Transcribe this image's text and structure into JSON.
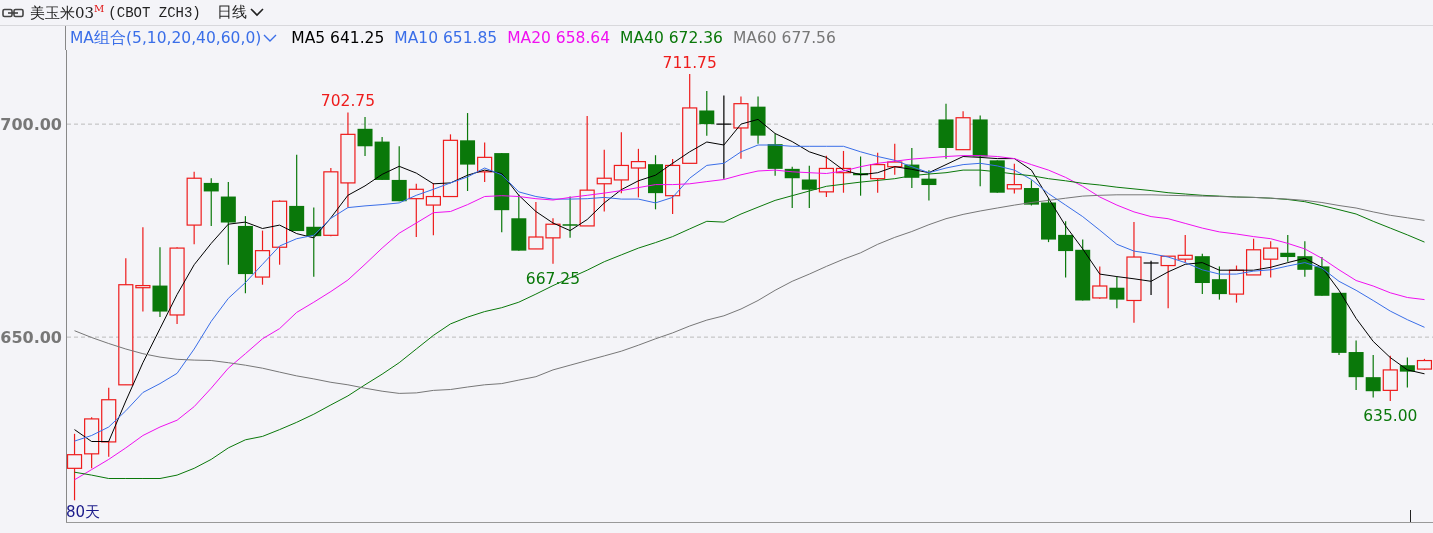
{
  "header": {
    "title": "美玉米03$^{M}$",
    "exchange": "(CBOT ZCH3)",
    "period": "日线"
  },
  "legend": {
    "indicator": "MA组合(5,10,20,40,60,0)",
    "values": [
      "641.25",
      "651.85",
      "658.64",
      "672.36",
      "677.56"
    ]
  },
  "chart": {
    "span_label": "80天",
    "chart_data": {
      "type": "candlestick",
      "categories": [
        null,
        null,
        null,
        null,
        null,
        null,
        null,
        null,
        null,
        null,
        null,
        null,
        null,
        null,
        null,
        null,
        null,
        null,
        null,
        null,
        null,
        null,
        null,
        null,
        null,
        null,
        null,
        null,
        null,
        null,
        null,
        null,
        null,
        null,
        null,
        null,
        null,
        null,
        null,
        null,
        null,
        null,
        null,
        null,
        null,
        null,
        null,
        null,
        null,
        null,
        null,
        null,
        null,
        null,
        null,
        null,
        null,
        null,
        null,
        null,
        null,
        null,
        null,
        null,
        null,
        null,
        null,
        null,
        null,
        null,
        null,
        null,
        null,
        null,
        null,
        null,
        null,
        null,
        null,
        null
      ],
      "ylim": [
        606.6,
        722.8
      ],
      "yticks": [
        {
          "value": 650,
          "label": "650.00"
        },
        {
          "value": 700,
          "label": "700.00"
        }
      ],
      "ohlc": [
        [
          619.2,
          627.3,
          611.7,
          622.4
        ],
        [
          622.6,
          631.2,
          619.2,
          630.8
        ],
        [
          625.4,
          638.1,
          621.9,
          635.3
        ],
        [
          638.8,
          668.5,
          638.8,
          662.3
        ],
        [
          661.6,
          675.8,
          656.0,
          662.1
        ],
        [
          662.1,
          671.1,
          654.7,
          656.0
        ],
        [
          655.2,
          671.1,
          653.1,
          670.9
        ],
        [
          676.3,
          688.8,
          671.8,
          687.3
        ],
        [
          686.2,
          687.3,
          676.1,
          684.2
        ],
        [
          683.0,
          686.4,
          667.0,
          676.9
        ],
        [
          676.1,
          678.4,
          660.3,
          664.8
        ],
        [
          664.1,
          675.0,
          662.3,
          670.3
        ],
        [
          671.1,
          682.1,
          667.0,
          681.9
        ],
        [
          680.8,
          692.8,
          674.9,
          674.9
        ],
        [
          675.9,
          680.4,
          664.2,
          673.7
        ],
        [
          673.9,
          689.7,
          673.7,
          688.8
        ],
        [
          686.2,
          702.75,
          680.4,
          697.6
        ],
        [
          698.9,
          701.7,
          692.5,
          694.8
        ],
        [
          695.9,
          697.0,
          686.9,
          686.9
        ],
        [
          686.9,
          694.8,
          681.9,
          681.9
        ],
        [
          682.5,
          686.0,
          673.5,
          684.7
        ],
        [
          681.0,
          686.2,
          673.9,
          683.0
        ],
        [
          683.0,
          697.6,
          683.0,
          696.2
        ],
        [
          696.2,
          702.6,
          684.3,
          690.5
        ],
        [
          688.8,
          695.7,
          686.4,
          692.2
        ],
        [
          693.2,
          693.2,
          674.6,
          679.8
        ],
        [
          677.9,
          683.4,
          670.3,
          670.3
        ],
        [
          670.7,
          681.7,
          670.7,
          673.5
        ],
        [
          673.3,
          677.9,
          667.25,
          676.5
        ],
        [
          676.5,
          683.0,
          673.3,
          676.2
        ],
        [
          676.1,
          701.9,
          676.1,
          684.5
        ],
        [
          686.0,
          694.0,
          679.5,
          687.3
        ],
        [
          686.9,
          698.1,
          683.8,
          690.3
        ],
        [
          689.7,
          694.2,
          682.8,
          691.2
        ],
        [
          690.6,
          692.7,
          680.0,
          683.8
        ],
        [
          683.2,
          691.8,
          678.9,
          690.3
        ],
        [
          690.8,
          711.75,
          690.8,
          703.8
        ],
        [
          703.2,
          707.8,
          697.3,
          700.0
        ],
        [
          700.0,
          706.7,
          687.2,
          700.0
        ],
        [
          699.1,
          706.5,
          691.9,
          704.8
        ],
        [
          704.1,
          706.5,
          695.4,
          697.3
        ],
        [
          695.3,
          697.8,
          687.9,
          689.5
        ],
        [
          689.5,
          690.0,
          680.3,
          687.3
        ],
        [
          687.0,
          690.2,
          680.3,
          684.6
        ],
        [
          684.1,
          692.6,
          682.9,
          689.6
        ],
        [
          688.6,
          693.7,
          683.9,
          689.6
        ],
        [
          688.5,
          692.4,
          683.2,
          688.0
        ],
        [
          687.2,
          693.3,
          683.9,
          690.5
        ],
        [
          690.0,
          695.4,
          688.1,
          691.1
        ],
        [
          690.5,
          694.4,
          685.0,
          687.4
        ],
        [
          687.2,
          689.2,
          682.1,
          685.7
        ],
        [
          701.1,
          704.8,
          691.9,
          694.4
        ],
        [
          694.0,
          703.0,
          694.0,
          701.5
        ],
        [
          701.1,
          702.0,
          685.4,
          692.4
        ],
        [
          691.5,
          691.5,
          683.9,
          683.9
        ],
        [
          684.8,
          690.7,
          683.7,
          685.8
        ],
        [
          685.0,
          686.8,
          680.9,
          681.1
        ],
        [
          681.6,
          682.6,
          672.3,
          672.9
        ],
        [
          674.0,
          677.2,
          664.0,
          670.2
        ],
        [
          670.5,
          672.9,
          658.6,
          658.6
        ],
        [
          659.2,
          666.6,
          659.0,
          662.0
        ],
        [
          661.6,
          664.2,
          656.8,
          658.8
        ],
        [
          658.6,
          677.0,
          653.4,
          668.8
        ],
        [
          667.4,
          667.9,
          659.9,
          667.4
        ],
        [
          666.8,
          669.0,
          656.8,
          669.0
        ],
        [
          668.3,
          674.0,
          667.5,
          669.2
        ],
        [
          669.0,
          669.6,
          660.1,
          662.7
        ],
        [
          663.6,
          666.6,
          658.8,
          660.1
        ],
        [
          660.1,
          666.8,
          658.1,
          665.7
        ],
        [
          664.6,
          673.1,
          664.6,
          670.5
        ],
        [
          668.3,
          672.5,
          664.0,
          670.9
        ],
        [
          669.8,
          674.0,
          667.7,
          668.8
        ],
        [
          669.0,
          672.5,
          664.2,
          665.8
        ],
        [
          666.6,
          668.8,
          659.7,
          659.7
        ],
        [
          660.4,
          660.4,
          645.8,
          646.3
        ],
        [
          646.5,
          649.2,
          637.6,
          640.6
        ],
        [
          640.6,
          645.8,
          635.8,
          637.3
        ],
        [
          637.5,
          645.6,
          635.0,
          642.3
        ],
        [
          643.4,
          645.2,
          638.2,
          641.9
        ],
        [
          642.5,
          644.9,
          642.3,
          644.5
        ]
      ],
      "series": [
        {
          "name": "MA5",
          "type": "line",
          "color": "#000000",
          "values": [
            628.3,
            625.5,
            625.5,
            635.0,
            644.0,
            652.0,
            660.0,
            667.0,
            672.0,
            676.5,
            677.0,
            675.5,
            676.3,
            674.3,
            673.3,
            678.0,
            683.3,
            685.5,
            688.2,
            690.1,
            688.5,
            686.0,
            686.2,
            688.0,
            689.2,
            688.4,
            683.3,
            679.5,
            676.8,
            675.0,
            677.6,
            681.5,
            684.6,
            686.7,
            688.0,
            690.8,
            693.5,
            695.8,
            695.1,
            700.0,
            701.1,
            697.8,
            695.9,
            693.5,
            692.2,
            689.2,
            688.1,
            688.6,
            690.0,
            689.4,
            688.6,
            690.5,
            692.4,
            692.2,
            691.9,
            691.9,
            689.2,
            682.6,
            676.1,
            670.7,
            664.8,
            664.2,
            663.7,
            663.1,
            665.3,
            667.1,
            667.5,
            665.7,
            665.7,
            665.7,
            666.4,
            667.5,
            668.5,
            666.4,
            661.0,
            654.4,
            649.0,
            645.2,
            642.3,
            641.4
          ]
        },
        {
          "name": "MA10",
          "type": "line",
          "color": "#3a6ee8",
          "values": [
            625.6,
            626.9,
            628.9,
            632.7,
            637.0,
            639.1,
            641.5,
            647.2,
            653.7,
            659.1,
            662.8,
            667.1,
            671.4,
            673.1,
            673.9,
            677.9,
            680.4,
            680.8,
            681.1,
            681.5,
            683.3,
            684.7,
            686.2,
            687.6,
            689.7,
            688.1,
            684.1,
            683.0,
            682.4,
            682.4,
            682.5,
            682.8,
            682.4,
            682.4,
            681.5,
            682.8,
            687.3,
            690.3,
            690.8,
            693.5,
            695.1,
            695.1,
            694.8,
            694.8,
            694.8,
            694.8,
            693.5,
            692.4,
            691.5,
            690.0,
            688.6,
            689.7,
            690.5,
            690.8,
            690.2,
            689.2,
            687.0,
            683.7,
            681.0,
            678.3,
            675.1,
            671.8,
            670.2,
            669.6,
            668.8,
            667.5,
            665.8,
            664.8,
            664.8,
            665.5,
            665.8,
            666.7,
            667.5,
            666.2,
            663.1,
            661.0,
            658.6,
            656.1,
            654.1,
            652.3
          ]
        },
        {
          "name": "MA20",
          "type": "line",
          "color": "#f010f0",
          "values": [
            616.5,
            618.9,
            621.3,
            624.0,
            626.9,
            628.9,
            630.5,
            633.7,
            638.0,
            642.7,
            646.1,
            649.6,
            652.0,
            655.8,
            658.2,
            660.7,
            663.4,
            667.1,
            670.9,
            674.4,
            676.8,
            679.2,
            679.5,
            681.1,
            683.0,
            683.2,
            683.0,
            682.5,
            682.2,
            682.8,
            683.3,
            683.8,
            684.4,
            685.1,
            685.8,
            685.8,
            686.0,
            686.5,
            687.0,
            688.1,
            689.0,
            689.2,
            688.8,
            688.6,
            688.4,
            689.0,
            690.0,
            690.8,
            691.3,
            691.8,
            692.1,
            692.4,
            692.6,
            692.6,
            692.4,
            691.9,
            690.5,
            689.2,
            687.5,
            685.4,
            682.9,
            681.0,
            679.4,
            678.3,
            677.8,
            676.7,
            675.6,
            674.7,
            674.2,
            673.6,
            673.1,
            672.0,
            670.7,
            668.5,
            665.8,
            663.3,
            662.0,
            660.4,
            659.3,
            658.8
          ]
        },
        {
          "name": "MA40",
          "type": "line",
          "color": "#0a780a",
          "values": [
            618.3,
            617.6,
            616.8,
            616.8,
            616.8,
            616.8,
            617.6,
            619.2,
            621.3,
            624.0,
            625.9,
            626.7,
            628.3,
            630.0,
            631.9,
            634.1,
            636.2,
            638.8,
            641.3,
            644.0,
            647.2,
            650.4,
            653.1,
            654.7,
            656.0,
            656.9,
            658.2,
            660.1,
            662.1,
            663.9,
            665.7,
            667.7,
            669.3,
            670.9,
            672.2,
            673.6,
            675.4,
            677.2,
            677.0,
            678.9,
            680.5,
            682.1,
            683.2,
            684.3,
            685.4,
            685.9,
            686.4,
            686.8,
            687.2,
            687.9,
            688.3,
            688.6,
            689.2,
            689.2,
            688.8,
            688.3,
            687.9,
            687.2,
            686.7,
            686.1,
            685.7,
            685.2,
            684.8,
            684.4,
            683.9,
            683.6,
            683.3,
            683.1,
            682.9,
            682.8,
            682.6,
            682.3,
            681.8,
            680.9,
            679.9,
            678.9,
            677.2,
            675.6,
            674.0,
            672.3
          ]
        },
        {
          "name": "MA60",
          "type": "line",
          "color": "#777777",
          "values": [
            651.5,
            649.9,
            648.5,
            647.2,
            646.1,
            645.3,
            644.8,
            644.6,
            644.5,
            644.0,
            643.4,
            642.7,
            641.8,
            640.9,
            640.2,
            639.4,
            638.8,
            638.0,
            637.3,
            636.8,
            636.9,
            637.5,
            637.7,
            638.3,
            638.8,
            639.1,
            639.9,
            640.7,
            642.3,
            643.4,
            644.5,
            645.6,
            646.7,
            648.1,
            649.6,
            651.0,
            652.6,
            654.0,
            655.0,
            656.6,
            658.6,
            661.0,
            663.1,
            664.8,
            666.6,
            668.3,
            669.8,
            671.8,
            673.4,
            674.8,
            676.4,
            677.8,
            678.8,
            679.6,
            680.3,
            681.0,
            681.6,
            682.1,
            682.6,
            683.1,
            683.3,
            683.4,
            683.4,
            683.4,
            683.3,
            683.2,
            683.1,
            683.0,
            682.9,
            682.8,
            682.6,
            682.4,
            682.1,
            681.6,
            680.9,
            680.3,
            679.4,
            678.6,
            678.0,
            677.4
          ]
        }
      ],
      "annotations": [
        {
          "text": "702.75",
          "y": 702.75
        },
        {
          "text": "667.25",
          "y": 667.25
        },
        {
          "text": "711.75",
          "y": 711.75
        },
        {
          "text": "635.00",
          "y": 635.0
        }
      ]
    }
  }
}
